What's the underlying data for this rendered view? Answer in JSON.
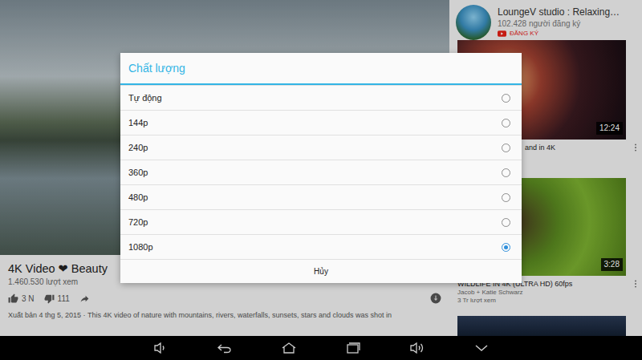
{
  "video": {
    "title": "4K Video ❤ Beauty",
    "views": "1.460.530 lượt xem",
    "likes": "3 N",
    "dislikes": "111",
    "description": "Xuất bản 4 thg 5, 2015 · This 4K video of nature with mountains, rivers, waterfalls, sunsets, stars and clouds was shot in"
  },
  "channel": {
    "name": "LoungeV studio : Relaxing…",
    "subscribers": "102.428 người đăng ký",
    "subscribe_label": "ĐĂNG KÝ"
  },
  "related": [
    {
      "title": "and in 4K",
      "duration": "12:24"
    },
    {
      "title": "WILDLIFE IN 4K (ULTRA HD) 60fps",
      "duration": "3:28",
      "author": "Jacob + Katie Schwarz",
      "views": "3 Tr lượt xem"
    }
  ],
  "quality_dialog": {
    "title": "Chất lượng",
    "options": [
      {
        "label": "Tự động",
        "selected": false
      },
      {
        "label": "144p",
        "selected": false
      },
      {
        "label": "240p",
        "selected": false
      },
      {
        "label": "360p",
        "selected": false
      },
      {
        "label": "480p",
        "selected": false
      },
      {
        "label": "720p",
        "selected": false
      },
      {
        "label": "1080p",
        "selected": true
      }
    ],
    "cancel": "Hủy"
  }
}
